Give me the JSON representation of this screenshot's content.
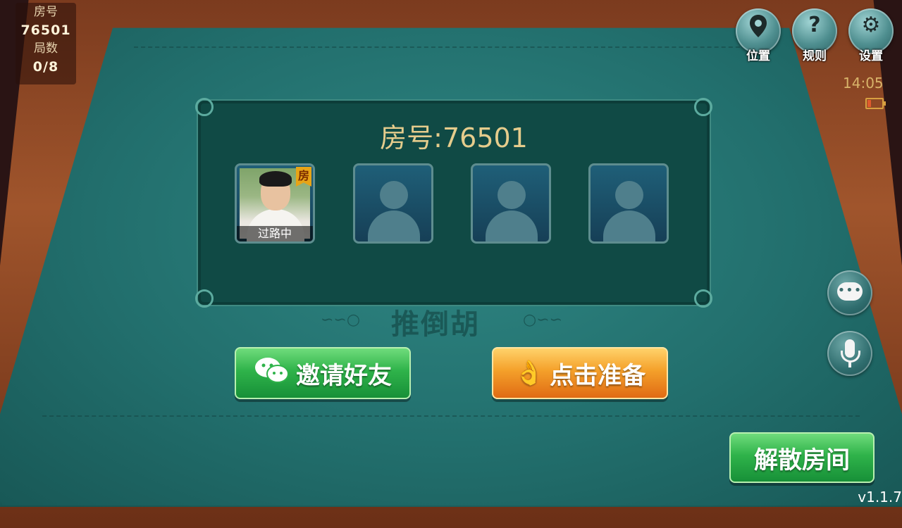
{
  "room_info": {
    "room_label": "房号",
    "room_number": "76501",
    "round_label": "局数",
    "round_value": "0/8"
  },
  "top_buttons": [
    {
      "icon": "location-pin-icon",
      "label": "位置"
    },
    {
      "icon": "question-mark-icon",
      "label": "规则"
    },
    {
      "icon": "gear-icon",
      "label": "设置"
    }
  ],
  "status_bar": {
    "time": "14:05",
    "battery_icon": "battery-low-icon"
  },
  "panel": {
    "title": "房号:76501",
    "seats": [
      {
        "occupied": true,
        "host_badge": "房",
        "status": "过路中"
      },
      {
        "occupied": false
      },
      {
        "occupied": false
      },
      {
        "occupied": false
      }
    ],
    "game_name": "推倒胡"
  },
  "actions": {
    "invite_label": "邀请好友",
    "invite_icon": "wechat-icon",
    "ready_label": "点击准备",
    "ready_icon": "hand-ok-icon",
    "dissolve_label": "解散房间"
  },
  "side_buttons": {
    "chat_icon": "chat-bubble-icon",
    "voice_icon": "microphone-icon"
  },
  "version": "v1.1.7",
  "colors": {
    "felt": "#226f6d",
    "panel": "#104a45",
    "title_gold": "#e5cc8c",
    "green_button": "#2fb34a",
    "orange_button": "#f4a02a"
  }
}
